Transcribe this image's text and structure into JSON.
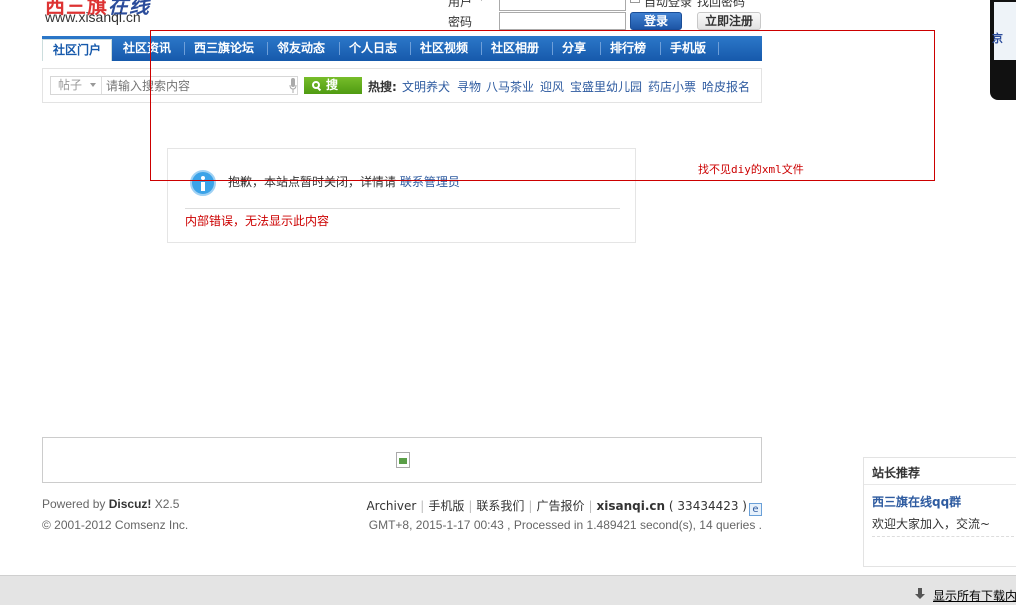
{
  "header": {
    "logo_cn_a": "西三旗",
    "logo_cn_b": "在线",
    "logo_en": "www.xisanqi.cn"
  },
  "login": {
    "user_label": "用户",
    "password_label": "密码",
    "auto_login": "自动登录",
    "forgot_password": "找回密码",
    "login_button": "登录",
    "register_button": "立即注册"
  },
  "nav": {
    "items": [
      "社区门户",
      "社区资讯",
      "西三旗论坛",
      "邻友动态",
      "个人日志",
      "社区视频",
      "社区相册",
      "分享",
      "排行榜",
      "手机版"
    ]
  },
  "search": {
    "type": "帖子",
    "placeholder": "请输入搜索内容",
    "button": "搜",
    "hot_label": "热搜:",
    "hot_links": [
      "文明养犬",
      "寻物",
      "八马茶业",
      "迎风",
      "宝盛里幼儿园",
      "药店小票",
      "哈皮报名"
    ]
  },
  "message": {
    "text": "抱歉，本站点暂时关闭，详情请",
    "contact_link": "联系管理员",
    "error": "内部错误，无法显示此内容"
  },
  "overlay": {
    "diy_error": "找不见diy的xml文件"
  },
  "footer": {
    "powered_prefix": "Powered by",
    "product": "Discuz!",
    "version": "X2.5",
    "copyright": "© 2001-2012 Comsenz Inc.",
    "links": [
      "Archiver",
      "手机版",
      "联系我们",
      "广告报价"
    ],
    "site": "xisanqi.cn",
    "icp": "( 33434423 )",
    "processed": "GMT+8, 2015-1-17 00:43 , Processed in 1.489421 second(s), 14 queries ."
  },
  "recommend": {
    "heading": "站长推荐",
    "title": "西三旗在线qq群",
    "desc": "欢迎大家加入，交流~"
  },
  "bottom_bar": {
    "download_link": "显示所有下载内"
  },
  "colors": {
    "nav_blue": "#1659ab",
    "link_blue": "#2e5ba0",
    "search_green": "#4f9b12",
    "error_red": "#cc0000"
  }
}
